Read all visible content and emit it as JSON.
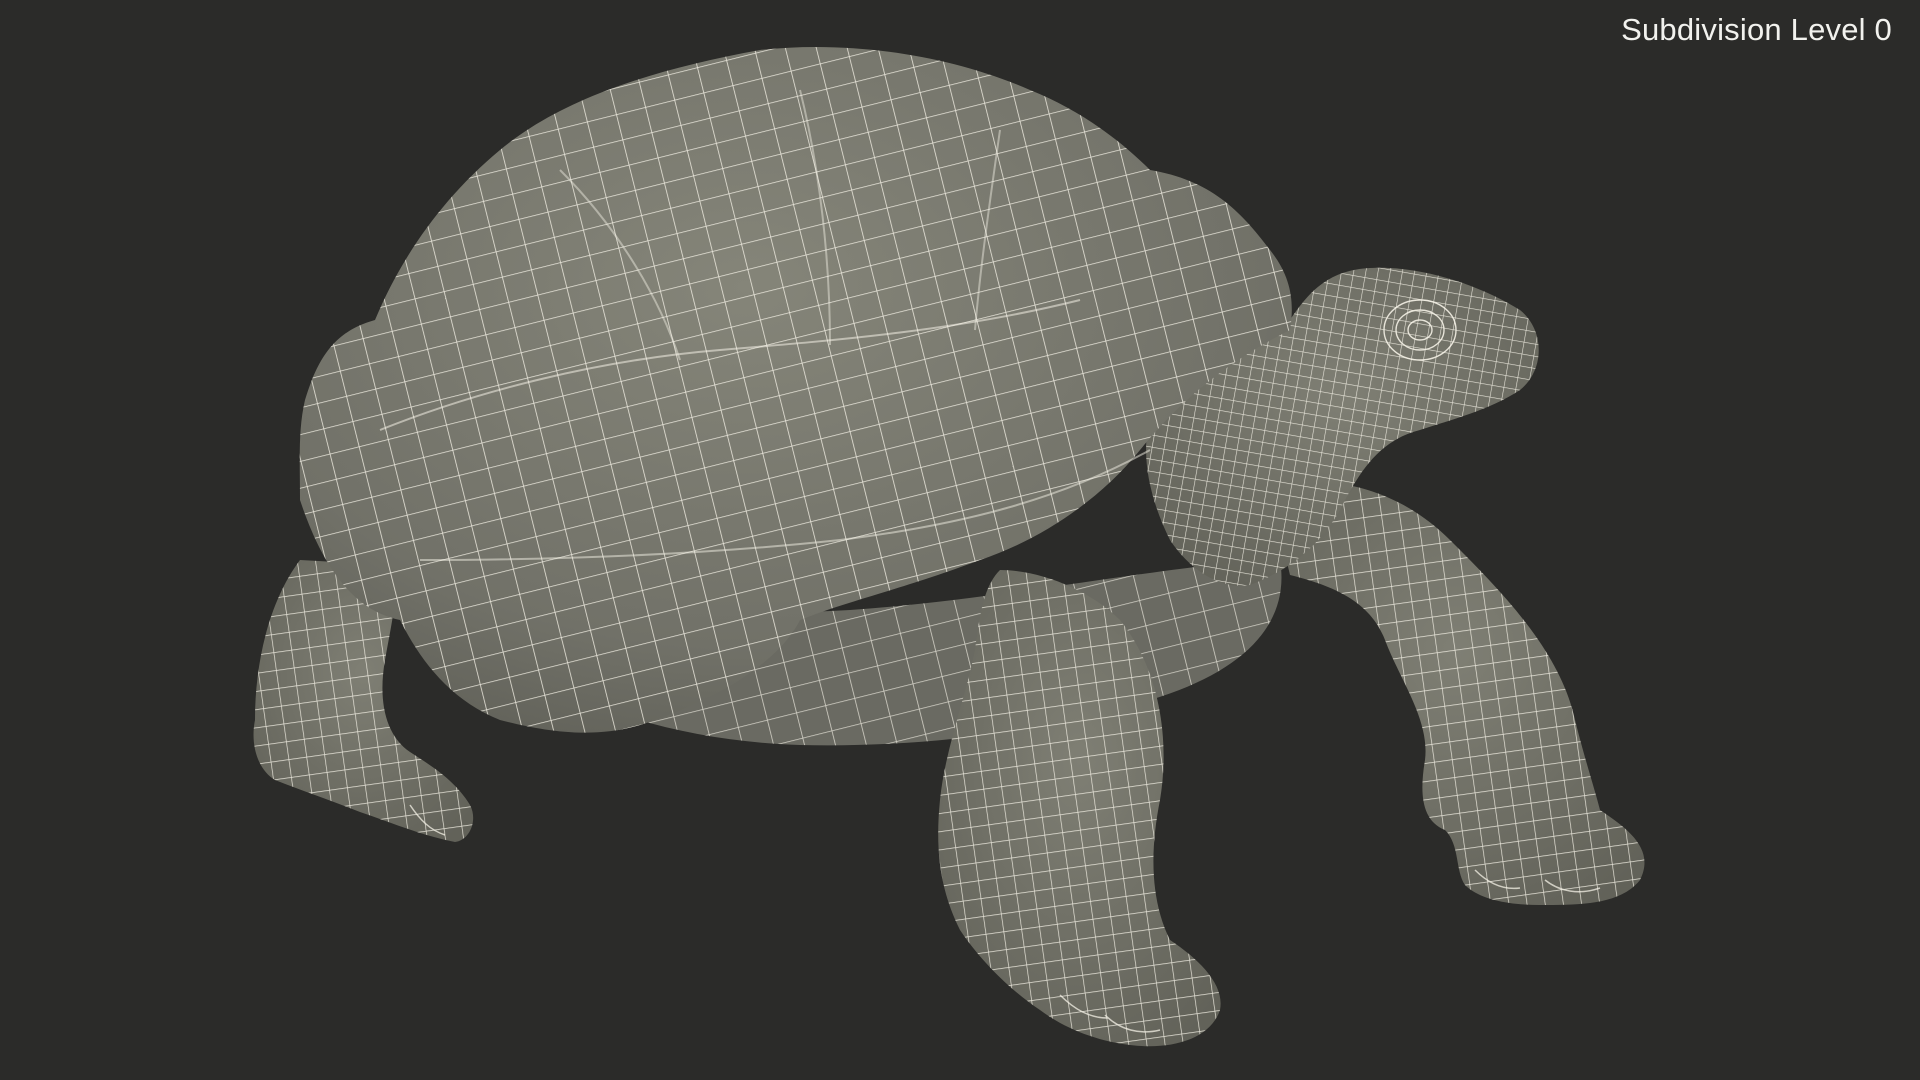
{
  "viewport": {
    "label": "Subdivision Level 0"
  },
  "model": {
    "subject": "tortoise",
    "style": "wireframe",
    "mesh_fill_color": "#7a7a70",
    "mesh_shadow_color": "#5c5c54",
    "wire_color": "#f4f1e6",
    "background_color": "#2b2b29"
  }
}
